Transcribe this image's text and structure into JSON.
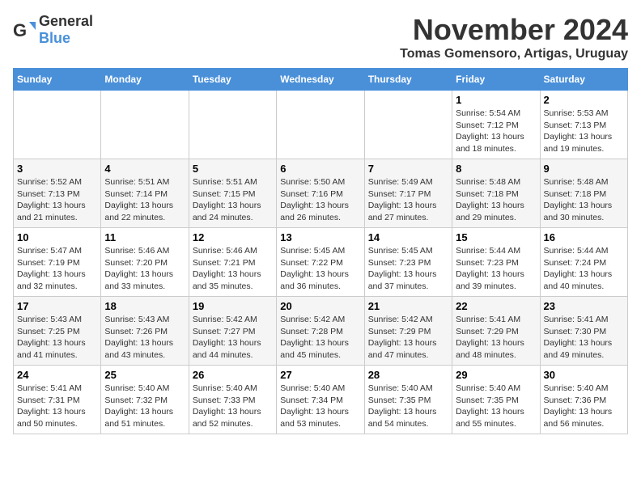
{
  "logo": {
    "general": "General",
    "blue": "Blue"
  },
  "header": {
    "month": "November 2024",
    "location": "Tomas Gomensoro, Artigas, Uruguay"
  },
  "weekdays": [
    "Sunday",
    "Monday",
    "Tuesday",
    "Wednesday",
    "Thursday",
    "Friday",
    "Saturday"
  ],
  "weeks": [
    [
      {
        "day": "",
        "info": ""
      },
      {
        "day": "",
        "info": ""
      },
      {
        "day": "",
        "info": ""
      },
      {
        "day": "",
        "info": ""
      },
      {
        "day": "",
        "info": ""
      },
      {
        "day": "1",
        "info": "Sunrise: 5:54 AM\nSunset: 7:12 PM\nDaylight: 13 hours and 18 minutes."
      },
      {
        "day": "2",
        "info": "Sunrise: 5:53 AM\nSunset: 7:13 PM\nDaylight: 13 hours and 19 minutes."
      }
    ],
    [
      {
        "day": "3",
        "info": "Sunrise: 5:52 AM\nSunset: 7:13 PM\nDaylight: 13 hours and 21 minutes."
      },
      {
        "day": "4",
        "info": "Sunrise: 5:51 AM\nSunset: 7:14 PM\nDaylight: 13 hours and 22 minutes."
      },
      {
        "day": "5",
        "info": "Sunrise: 5:51 AM\nSunset: 7:15 PM\nDaylight: 13 hours and 24 minutes."
      },
      {
        "day": "6",
        "info": "Sunrise: 5:50 AM\nSunset: 7:16 PM\nDaylight: 13 hours and 26 minutes."
      },
      {
        "day": "7",
        "info": "Sunrise: 5:49 AM\nSunset: 7:17 PM\nDaylight: 13 hours and 27 minutes."
      },
      {
        "day": "8",
        "info": "Sunrise: 5:48 AM\nSunset: 7:18 PM\nDaylight: 13 hours and 29 minutes."
      },
      {
        "day": "9",
        "info": "Sunrise: 5:48 AM\nSunset: 7:18 PM\nDaylight: 13 hours and 30 minutes."
      }
    ],
    [
      {
        "day": "10",
        "info": "Sunrise: 5:47 AM\nSunset: 7:19 PM\nDaylight: 13 hours and 32 minutes."
      },
      {
        "day": "11",
        "info": "Sunrise: 5:46 AM\nSunset: 7:20 PM\nDaylight: 13 hours and 33 minutes."
      },
      {
        "day": "12",
        "info": "Sunrise: 5:46 AM\nSunset: 7:21 PM\nDaylight: 13 hours and 35 minutes."
      },
      {
        "day": "13",
        "info": "Sunrise: 5:45 AM\nSunset: 7:22 PM\nDaylight: 13 hours and 36 minutes."
      },
      {
        "day": "14",
        "info": "Sunrise: 5:45 AM\nSunset: 7:23 PM\nDaylight: 13 hours and 37 minutes."
      },
      {
        "day": "15",
        "info": "Sunrise: 5:44 AM\nSunset: 7:23 PM\nDaylight: 13 hours and 39 minutes."
      },
      {
        "day": "16",
        "info": "Sunrise: 5:44 AM\nSunset: 7:24 PM\nDaylight: 13 hours and 40 minutes."
      }
    ],
    [
      {
        "day": "17",
        "info": "Sunrise: 5:43 AM\nSunset: 7:25 PM\nDaylight: 13 hours and 41 minutes."
      },
      {
        "day": "18",
        "info": "Sunrise: 5:43 AM\nSunset: 7:26 PM\nDaylight: 13 hours and 43 minutes."
      },
      {
        "day": "19",
        "info": "Sunrise: 5:42 AM\nSunset: 7:27 PM\nDaylight: 13 hours and 44 minutes."
      },
      {
        "day": "20",
        "info": "Sunrise: 5:42 AM\nSunset: 7:28 PM\nDaylight: 13 hours and 45 minutes."
      },
      {
        "day": "21",
        "info": "Sunrise: 5:42 AM\nSunset: 7:29 PM\nDaylight: 13 hours and 47 minutes."
      },
      {
        "day": "22",
        "info": "Sunrise: 5:41 AM\nSunset: 7:29 PM\nDaylight: 13 hours and 48 minutes."
      },
      {
        "day": "23",
        "info": "Sunrise: 5:41 AM\nSunset: 7:30 PM\nDaylight: 13 hours and 49 minutes."
      }
    ],
    [
      {
        "day": "24",
        "info": "Sunrise: 5:41 AM\nSunset: 7:31 PM\nDaylight: 13 hours and 50 minutes."
      },
      {
        "day": "25",
        "info": "Sunrise: 5:40 AM\nSunset: 7:32 PM\nDaylight: 13 hours and 51 minutes."
      },
      {
        "day": "26",
        "info": "Sunrise: 5:40 AM\nSunset: 7:33 PM\nDaylight: 13 hours and 52 minutes."
      },
      {
        "day": "27",
        "info": "Sunrise: 5:40 AM\nSunset: 7:34 PM\nDaylight: 13 hours and 53 minutes."
      },
      {
        "day": "28",
        "info": "Sunrise: 5:40 AM\nSunset: 7:35 PM\nDaylight: 13 hours and 54 minutes."
      },
      {
        "day": "29",
        "info": "Sunrise: 5:40 AM\nSunset: 7:35 PM\nDaylight: 13 hours and 55 minutes."
      },
      {
        "day": "30",
        "info": "Sunrise: 5:40 AM\nSunset: 7:36 PM\nDaylight: 13 hours and 56 minutes."
      }
    ]
  ]
}
